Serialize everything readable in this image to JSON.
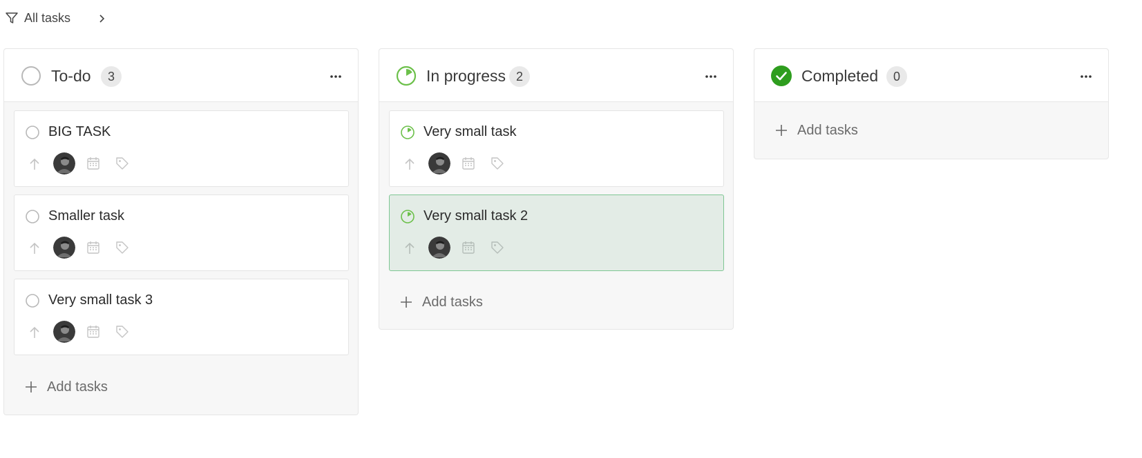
{
  "toolbar": {
    "filter_label": "All tasks"
  },
  "columns": [
    {
      "title": "To-do",
      "count": "3",
      "status": "not-started",
      "add_label": "Add tasks",
      "tasks": [
        {
          "title": "BIG TASK"
        },
        {
          "title": "Smaller task"
        },
        {
          "title": "Very small task 3"
        }
      ]
    },
    {
      "title": "In progress",
      "count": "2",
      "status": "in-progress",
      "add_label": "Add tasks",
      "tasks": [
        {
          "title": "Very small task"
        },
        {
          "title": "Very small task 2",
          "selected": true
        }
      ]
    },
    {
      "title": "Completed",
      "count": "0",
      "status": "completed",
      "add_label": "Add tasks",
      "tasks": []
    }
  ],
  "colors": {
    "progress_green": "#6cc04a",
    "complete_green": "#2e9d1e",
    "selected_bg": "#e3ece6",
    "selected_border": "#7ec693",
    "icon_gray": "#c4c4c4"
  },
  "icons": {
    "filter": "filter-icon",
    "chevron": "chevron-right-icon",
    "more": "more-horizontal-icon",
    "priority": "arrow-up-icon",
    "date": "calendar-icon",
    "tags": "tag-icon",
    "add": "plus-icon",
    "avatar": "user-avatar"
  }
}
